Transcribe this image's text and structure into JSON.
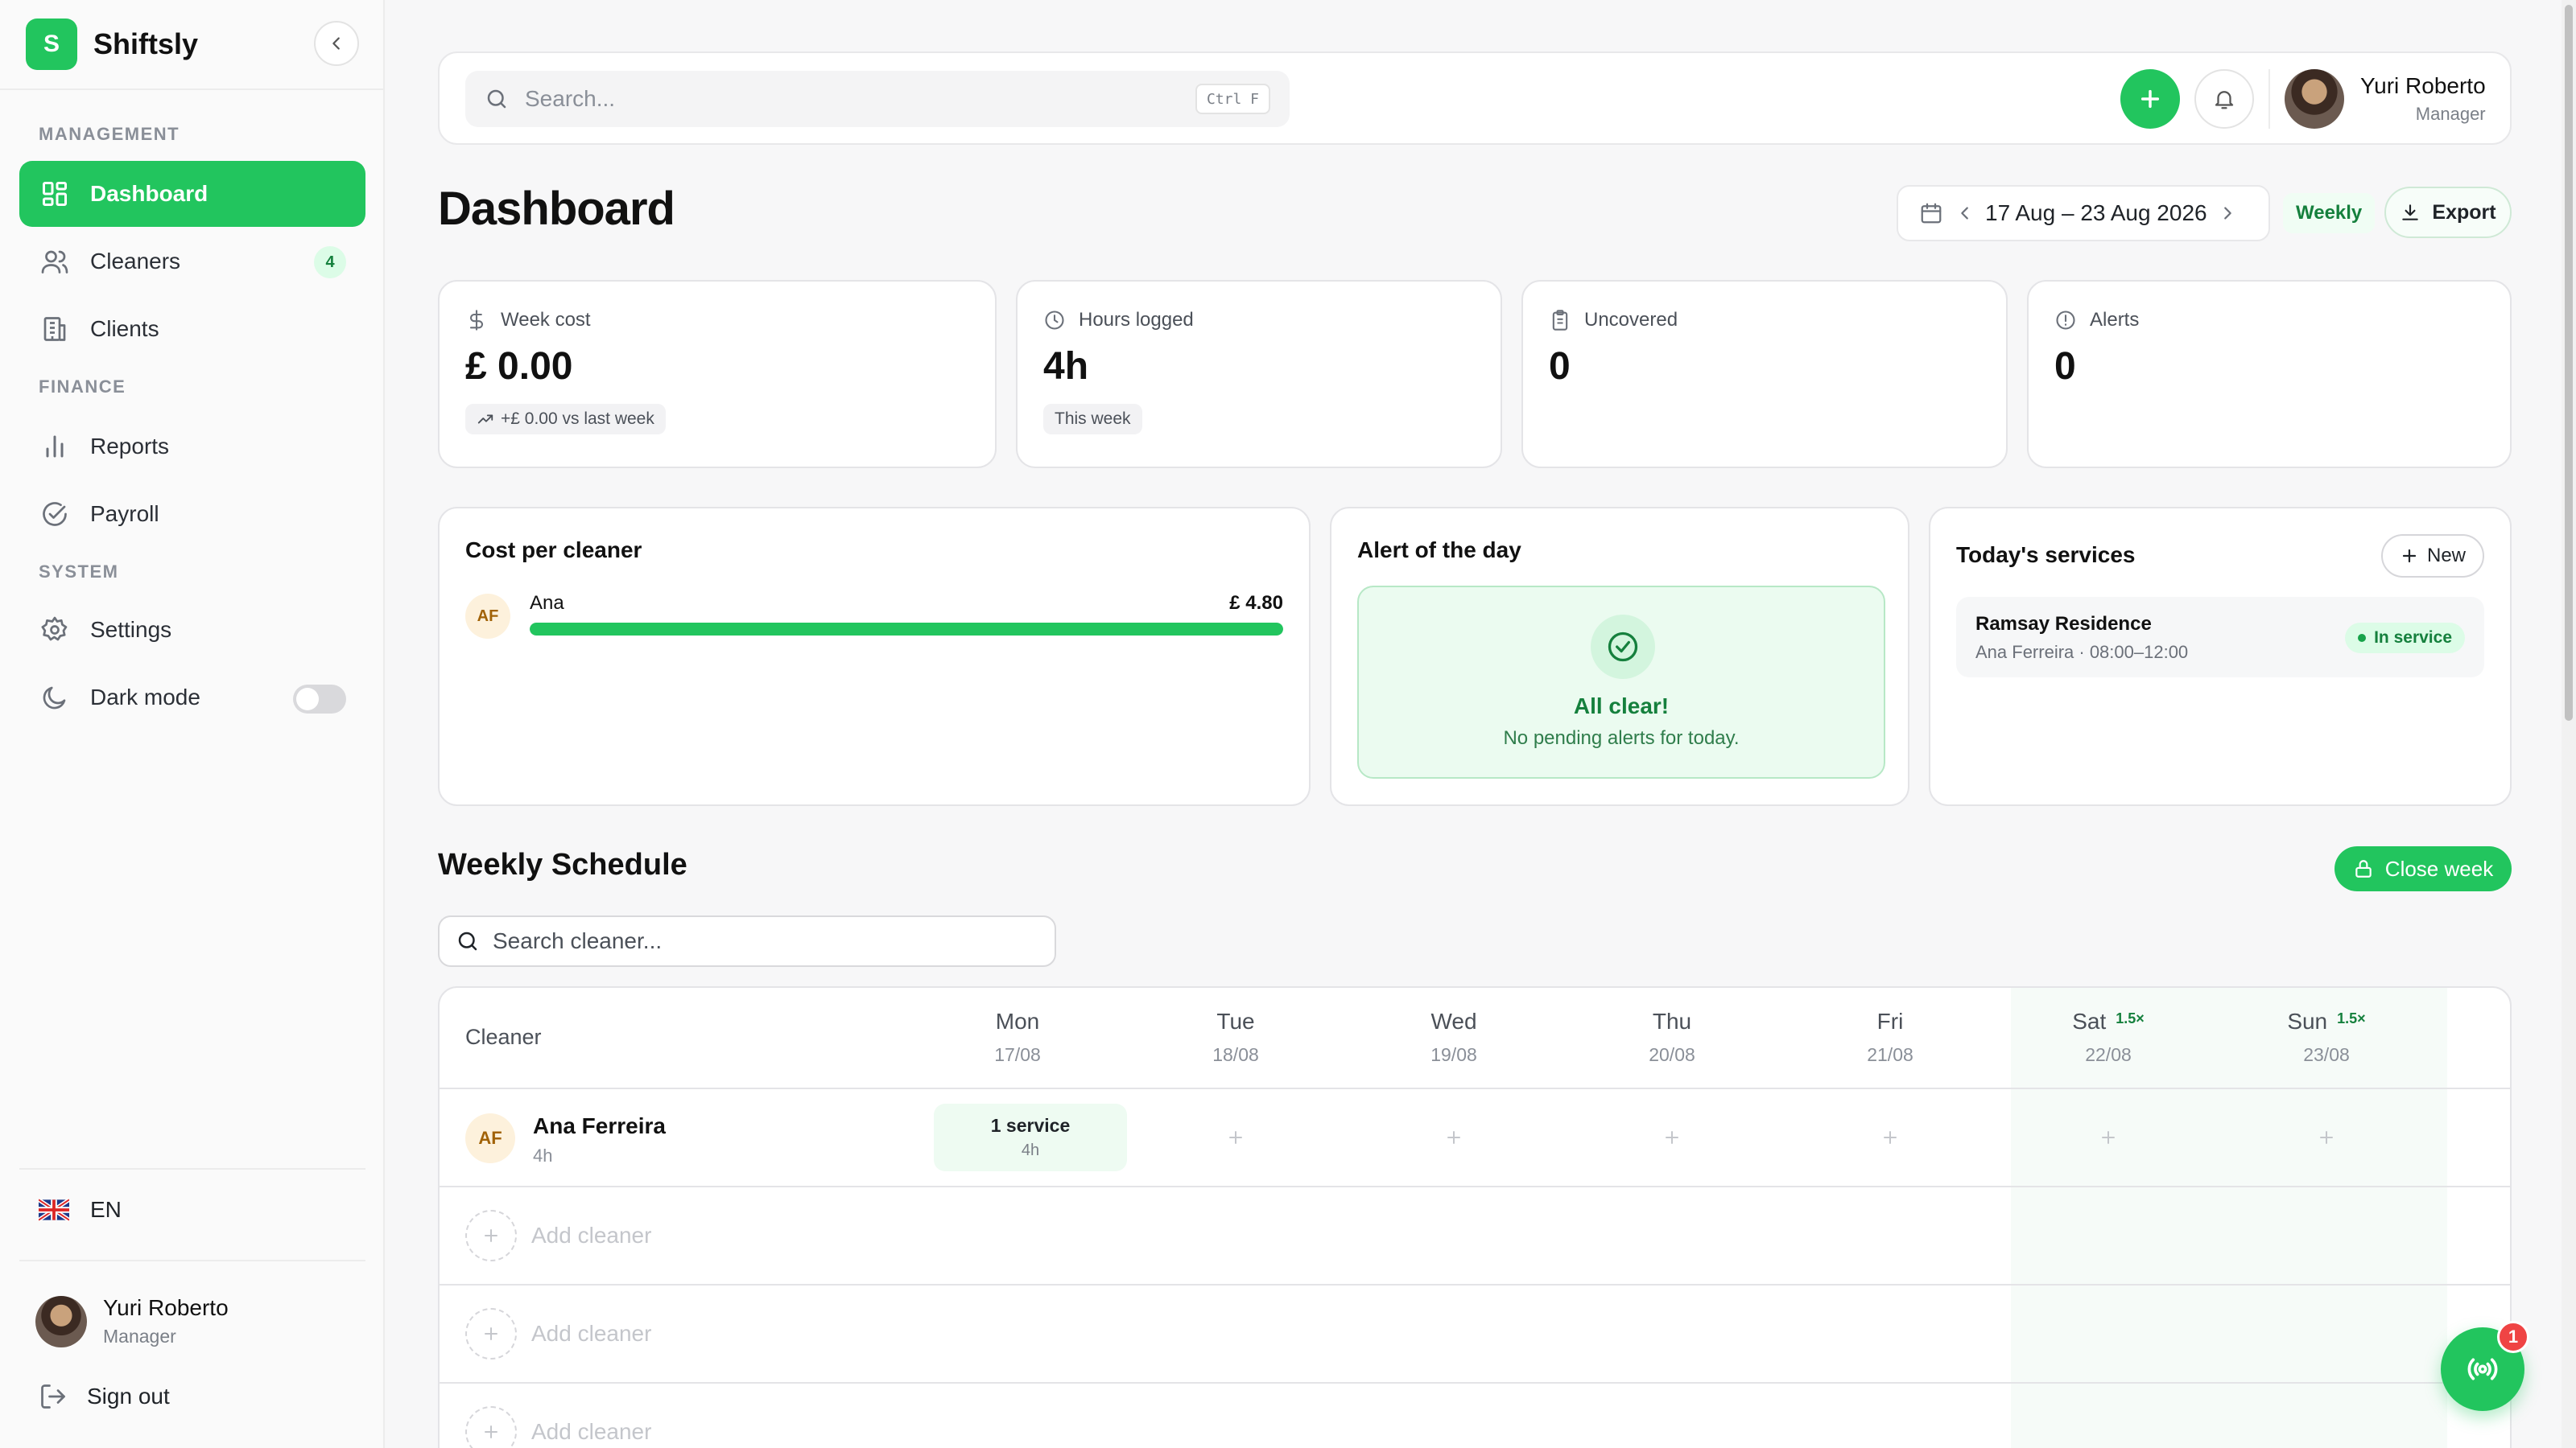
{
  "app": {
    "name": "Shiftsly",
    "logo_letter": "S",
    "accent": "#22c55e"
  },
  "sidebar": {
    "sections": {
      "management": "MANAGEMENT",
      "finance": "FINANCE",
      "system": "SYSTEM"
    },
    "items": {
      "dashboard": {
        "label": "Dashboard",
        "icon": "grid-icon",
        "active": true
      },
      "cleaners": {
        "label": "Cleaners",
        "icon": "users-icon",
        "badge": "4"
      },
      "clients": {
        "label": "Clients",
        "icon": "building-icon"
      },
      "reports": {
        "label": "Reports",
        "icon": "bar-chart-icon"
      },
      "payroll": {
        "label": "Payroll",
        "icon": "check-circle-icon"
      },
      "settings": {
        "label": "Settings",
        "icon": "gear-icon"
      },
      "dark_mode": {
        "label": "Dark mode",
        "icon": "moon-icon",
        "enabled": false
      }
    },
    "language": "EN",
    "user": {
      "name": "Yuri Roberto",
      "role": "Manager"
    },
    "sign_out": "Sign out"
  },
  "header": {
    "search_placeholder": "Search...",
    "search_shortcut": "Ctrl F",
    "user": {
      "name": "Yuri Roberto",
      "role": "Manager"
    }
  },
  "page": {
    "title": "Dashboard",
    "date_range": "17 Aug – 23 Aug 2026",
    "period": "Weekly",
    "export_label": "Export"
  },
  "stats": {
    "week_cost": {
      "label": "Week cost",
      "value": "£ 0.00",
      "chip": "+£ 0.00 vs last week"
    },
    "hours_logged": {
      "label": "Hours logged",
      "value": "4h",
      "chip": "This week"
    },
    "uncovered": {
      "label": "Uncovered",
      "value": "0"
    },
    "alerts": {
      "label": "Alerts",
      "value": "0"
    }
  },
  "cost_per_cleaner": {
    "title": "Cost per cleaner",
    "items": [
      {
        "initials": "AF",
        "name": "Ana",
        "value": "£ 4.80",
        "share": 1.0
      }
    ]
  },
  "alert_of_day": {
    "title": "Alert of the day",
    "status": "All clear!",
    "message": "No pending alerts for today."
  },
  "todays_services": {
    "title": "Today's services",
    "new_label": "New",
    "items": [
      {
        "title": "Ramsay Residence",
        "subtitle": "Ana Ferreira · 08:00–12:00",
        "status": "In service"
      }
    ]
  },
  "schedule": {
    "title": "Weekly Schedule",
    "close_week_label": "Close week",
    "search_placeholder": "Search cleaner...",
    "cleaner_column": "Cleaner",
    "days": [
      {
        "name": "Mon",
        "date": "17/08",
        "multiplier": ""
      },
      {
        "name": "Tue",
        "date": "18/08",
        "multiplier": ""
      },
      {
        "name": "Wed",
        "date": "19/08",
        "multiplier": ""
      },
      {
        "name": "Thu",
        "date": "20/08",
        "multiplier": ""
      },
      {
        "name": "Fri",
        "date": "21/08",
        "multiplier": ""
      },
      {
        "name": "Sat",
        "date": "22/08",
        "multiplier": "1.5×"
      },
      {
        "name": "Sun",
        "date": "23/08",
        "multiplier": "1.5×"
      }
    ],
    "rows": [
      {
        "initials": "AF",
        "name": "Ana Ferreira",
        "hours": "4h",
        "mon": {
          "title": "1 service",
          "hours": "4h"
        }
      }
    ],
    "add_cleaner_label": "Add cleaner"
  },
  "fab": {
    "icon": "broadcast-icon",
    "badge": "1"
  }
}
